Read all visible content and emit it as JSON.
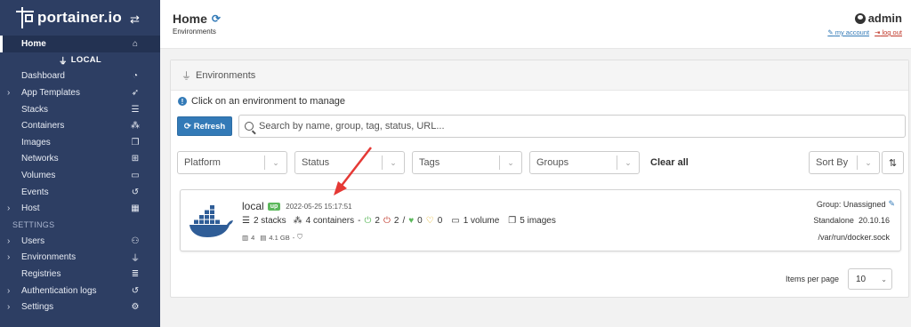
{
  "brand": {
    "name": "portainer.io"
  },
  "sidebar": {
    "home": "Home",
    "environment_label": "LOCAL",
    "env_items": [
      {
        "label": "Dashboard",
        "icon": "dashboard-icon",
        "glyph": "◔"
      },
      {
        "label": "App Templates",
        "icon": "rocket-icon",
        "glyph": "➶"
      },
      {
        "label": "Stacks",
        "icon": "list-icon",
        "glyph": "☰"
      },
      {
        "label": "Containers",
        "icon": "cubes-icon",
        "glyph": "⁂"
      },
      {
        "label": "Images",
        "icon": "clone-icon",
        "glyph": "❐"
      },
      {
        "label": "Networks",
        "icon": "sitemap-icon",
        "glyph": "⊞"
      },
      {
        "label": "Volumes",
        "icon": "hdd-icon",
        "glyph": "▭"
      },
      {
        "label": "Events",
        "icon": "history-icon",
        "glyph": "↺"
      },
      {
        "label": "Host",
        "icon": "th-icon",
        "glyph": "▦"
      }
    ],
    "settings_section": "SETTINGS",
    "settings_items": [
      {
        "label": "Users",
        "icon": "users-icon",
        "glyph": "👥"
      },
      {
        "label": "Environments",
        "icon": "plug-icon",
        "glyph": "⏚"
      },
      {
        "label": "Registries",
        "icon": "database-icon",
        "glyph": "≣"
      },
      {
        "label": "Authentication logs",
        "icon": "history-icon",
        "glyph": "↺"
      },
      {
        "label": "Settings",
        "icon": "cogs-icon",
        "glyph": "⚙"
      }
    ]
  },
  "header": {
    "title": "Home",
    "breadcrumb": "Environments",
    "user": "admin",
    "my_account": "my account",
    "log_out": "log out"
  },
  "panel": {
    "title": "Environments",
    "hint": "Click on an environment to manage",
    "refresh_label": "Refresh",
    "search_placeholder": "Search by name, group, tag, status, URL...",
    "filters": {
      "platform": "Platform",
      "status": "Status",
      "tags": "Tags",
      "groups": "Groups",
      "sort": "Sort By"
    },
    "clear_all": "Clear all"
  },
  "environment": {
    "name": "local",
    "status": "up",
    "timestamp": "2022-05-25 15:17:51",
    "stacks": "2 stacks",
    "containers": "4 containers",
    "running": "2",
    "stopped": "2",
    "healthy": "0",
    "unhealthy": "0",
    "volumes": "1 volume",
    "images": "5 images",
    "cpu": "4",
    "memory": "4.1 GB",
    "group": "Group: Unassigned",
    "type": "Standalone",
    "version": "20.10.16",
    "url": "/var/run/docker.sock"
  },
  "pagination": {
    "items_per_page_label": "Items per page",
    "items_per_page_value": "10"
  },
  "colors": {
    "sidebar": "#2d3e63",
    "primary": "#337ab7",
    "up": "#5cb85c",
    "docker": "#2f5d97",
    "annotation_arrow": "#e53935"
  }
}
